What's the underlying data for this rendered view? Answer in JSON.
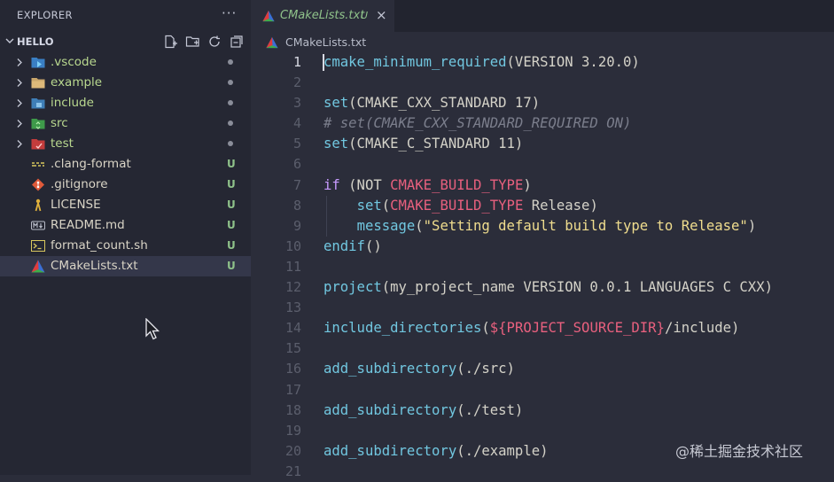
{
  "sidebar": {
    "title": "EXPLORER",
    "more": "···",
    "section": "HELLO",
    "items": [
      {
        "label": "vscode_folder",
        "text": ".vscode",
        "status": "dot"
      },
      {
        "label": "example_folder",
        "text": "example",
        "status": "dot"
      },
      {
        "label": "include_folder",
        "text": "include",
        "status": "dot"
      },
      {
        "label": "src_folder",
        "text": "src",
        "status": "dot"
      },
      {
        "label": "test_folder",
        "text": "test",
        "status": "dot"
      },
      {
        "label": "clang_format",
        "text": ".clang-format",
        "status": "U"
      },
      {
        "label": "gitignore",
        "text": ".gitignore",
        "status": "U"
      },
      {
        "label": "license",
        "text": "LICENSE",
        "status": "U"
      },
      {
        "label": "readme",
        "text": "README.md",
        "status": "U"
      },
      {
        "label": "format_count",
        "text": "format_count.sh",
        "status": "U"
      },
      {
        "label": "cmakelists",
        "text": "CMakeLists.txt",
        "status": "U"
      }
    ]
  },
  "editor": {
    "tab": {
      "name": "CMakeLists.txt",
      "status": "U",
      "close": "×"
    },
    "breadcrumb": "CMakeLists.txt",
    "line_numbers": [
      "1",
      "2",
      "3",
      "4",
      "5",
      "6",
      "7",
      "8",
      "9",
      "10",
      "11",
      "12",
      "13",
      "14",
      "15",
      "16",
      "17",
      "18",
      "19",
      "20",
      "21"
    ],
    "code": {
      "l1_fn": "cmake_minimum_required",
      "l1_rest": "(VERSION 3.20.0)",
      "l3_fn": "set",
      "l3_rest": "(CMAKE_CXX_STANDARD 17)",
      "l4": "# set(CMAKE_CXX_STANDARD_REQUIRED ON)",
      "l5_fn": "set",
      "l5_rest": "(CMAKE_C_STANDARD 11)",
      "l7_kw": "if",
      "l7_a": " (NOT ",
      "l7_var": "CMAKE_BUILD_TYPE",
      "l7_b": ")",
      "l8_fn": "set",
      "l8_a": "(",
      "l8_var": "CMAKE_BUILD_TYPE",
      "l8_b": " Release)",
      "l9_fn": "message",
      "l9_a": "(",
      "l9_str": "\"Setting default build type to Release\"",
      "l9_b": ")",
      "l10_fn": "endif",
      "l10_rest": "()",
      "l12_fn": "project",
      "l12_rest": "(my_project_name VERSION 0.0.1 LANGUAGES C CXX)",
      "l14_fn": "include_directories",
      "l14_a": "(",
      "l14_var": "${PROJECT_SOURCE_DIR}",
      "l14_b": "/include)",
      "l16_fn": "add_subdirectory",
      "l16_rest": "(./src)",
      "l18_fn": "add_subdirectory",
      "l18_rest": "(./test)",
      "l20_fn": "add_subdirectory",
      "l20_rest": "(./example)"
    }
  },
  "watermark": "@稀土掘金技术社区"
}
